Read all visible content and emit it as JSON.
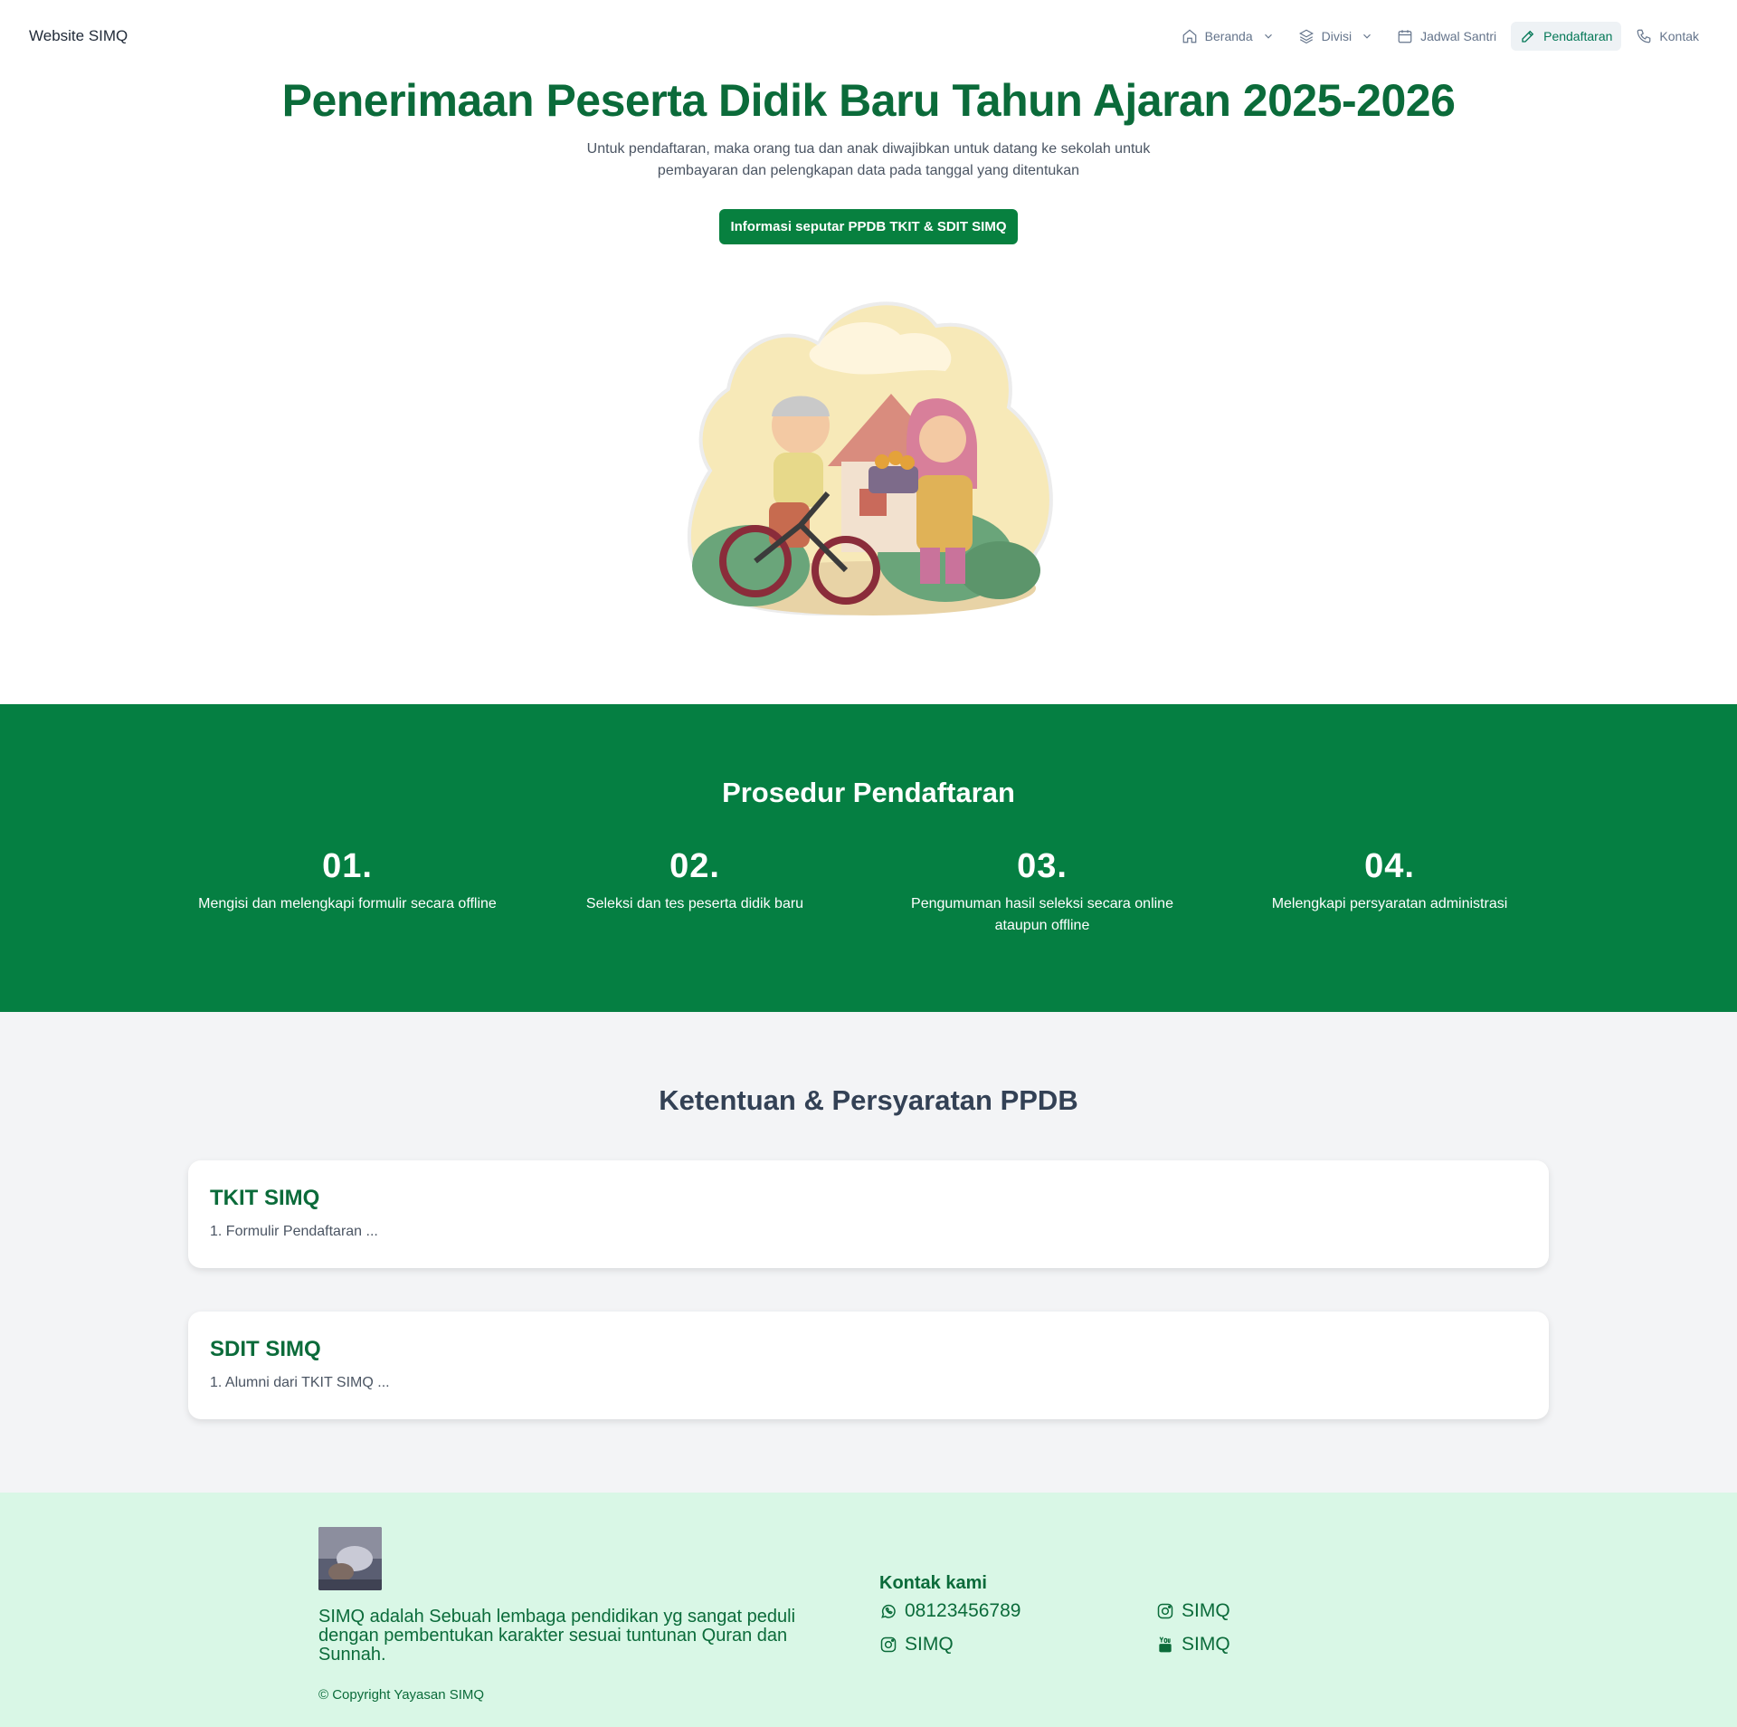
{
  "nav": {
    "brand": "Website SIMQ",
    "items": [
      {
        "label": "Beranda"
      },
      {
        "label": "Divisi"
      },
      {
        "label": "Jadwal Santri"
      },
      {
        "label": "Pendaftaran"
      },
      {
        "label": "Kontak"
      }
    ]
  },
  "hero": {
    "title": "Penerimaan Peserta Didik Baru Tahun Ajaran 2025-2026",
    "subtitle": "Untuk pendaftaran, maka orang tua dan anak diwajibkan untuk datang ke sekolah untuk pembayaran dan pelengkapan data pada tanggal yang ditentukan",
    "button_label": "Informasi seputar PPDB TKIT & SDIT SIMQ"
  },
  "prosedur": {
    "title": "Prosedur Pendaftaran",
    "steps": [
      {
        "num": "01.",
        "text": "Mengisi dan melengkapi formulir secara offline"
      },
      {
        "num": "02.",
        "text": "Seleksi dan tes peserta didik baru"
      },
      {
        "num": "03.",
        "text": "Pengumuman hasil seleksi secara online ataupun offline"
      },
      {
        "num": "04.",
        "text": "Melengkapi persyaratan administrasi"
      }
    ]
  },
  "ketentuan": {
    "title": "Ketentuan & Persyaratan PPDB",
    "cards": [
      {
        "title": "TKIT SIMQ",
        "text": "1. Formulir Pendaftaran ..."
      },
      {
        "title": "SDIT SIMQ",
        "text": "1. Alumni dari TKIT SIMQ ..."
      }
    ]
  },
  "footer": {
    "about": "SIMQ adalah Sebuah lembaga pendidikan yg sangat peduli dengan pembentukan karakter sesuai tuntunan Quran dan Sunnah.",
    "copyright": "© Copyright Yayasan SIMQ",
    "contact_title": "Kontak kami",
    "whatsapp": "08123456789",
    "instagram_1": "SIMQ",
    "instagram_2": "SIMQ",
    "youtube": "SIMQ"
  },
  "colors": {
    "primary": "#0b6b3a",
    "section_green": "#057f42",
    "button": "#07803f",
    "footer_bg": "#d9f7e6"
  }
}
